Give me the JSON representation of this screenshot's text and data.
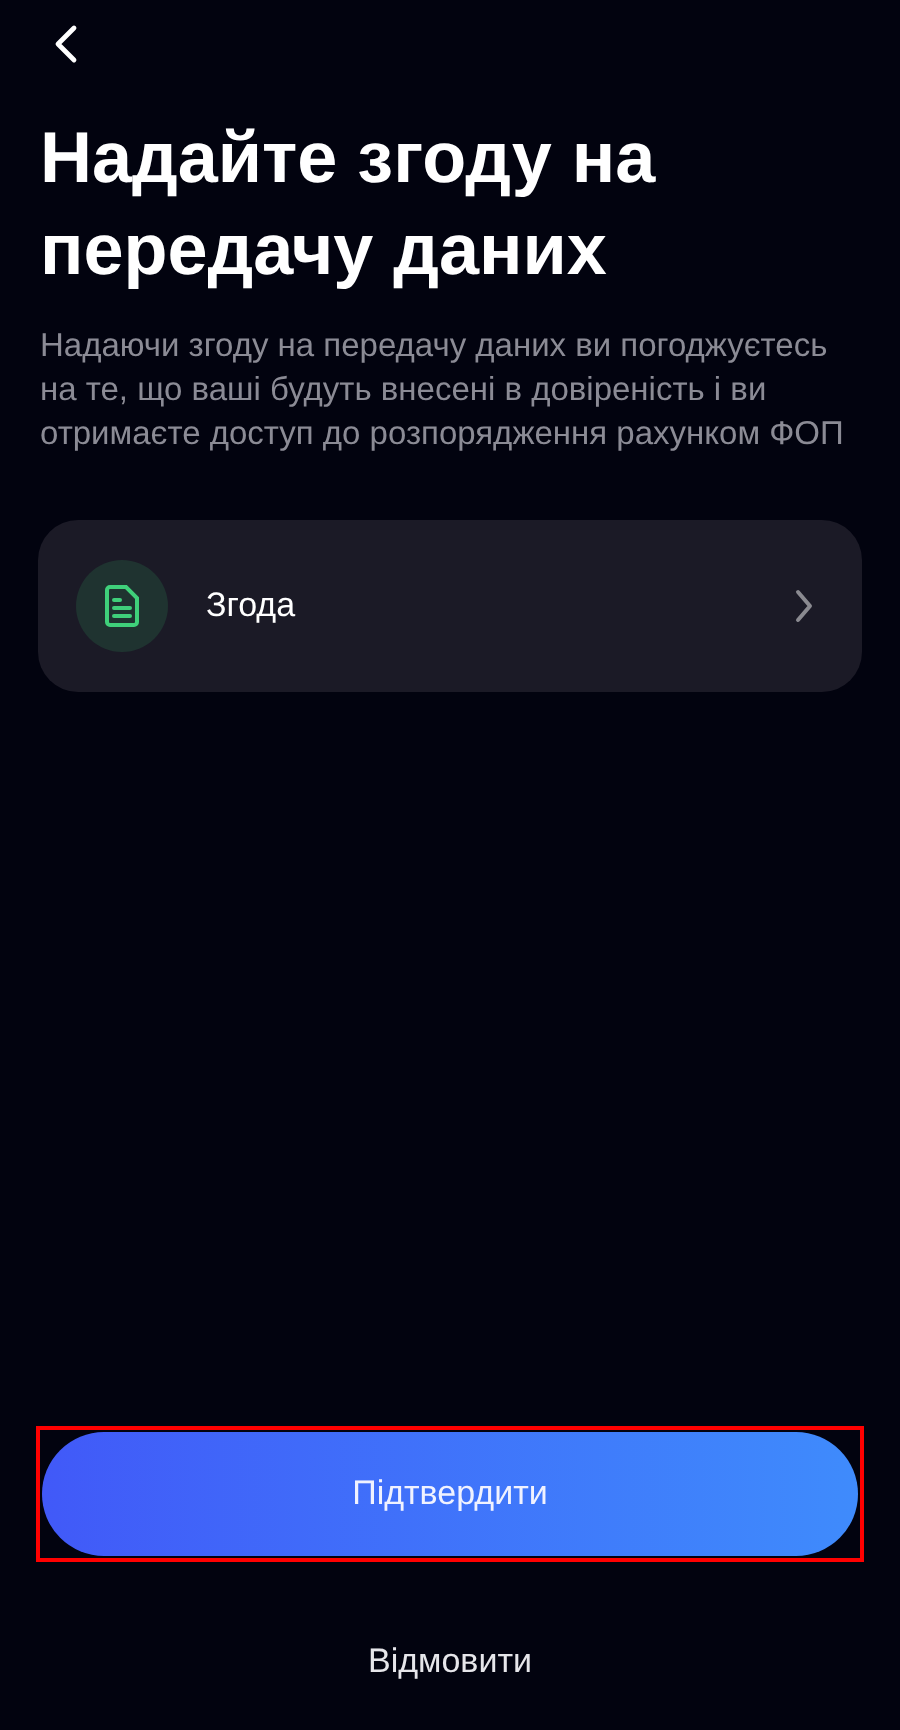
{
  "title": "Надайте згоду на передачу даних",
  "description": "Надаючи згоду на передачу даних ви погоджуєтесь на те, що ваші будуть внесені в довіреність і ви отримаєте доступ до розпорядження рахунком ФОП",
  "documents": [
    {
      "label": "Згода"
    }
  ],
  "confirm_button": {
    "label": "Підтвердити",
    "highlighted": true
  },
  "decline_button": {
    "label": "Відмовити"
  }
}
